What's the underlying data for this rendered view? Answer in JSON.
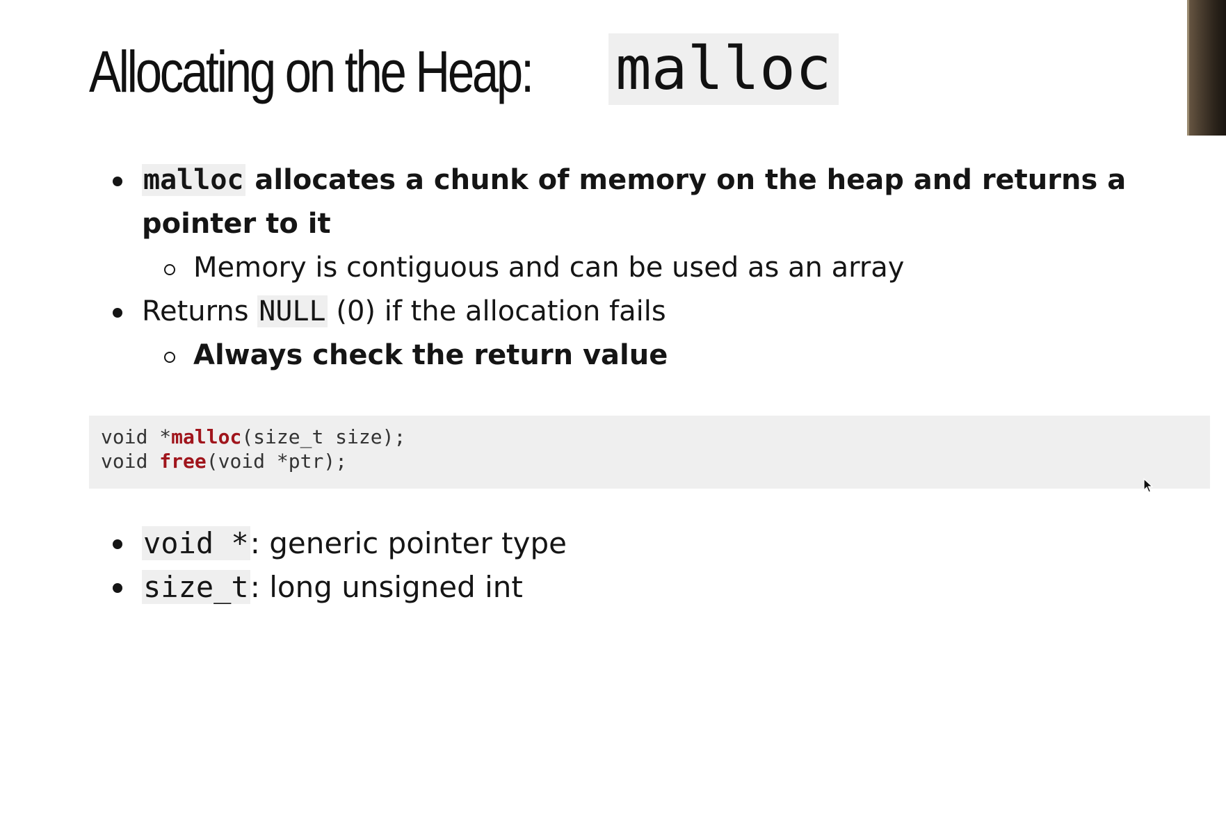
{
  "title": {
    "text": "Allocating on the Heap: ",
    "code": "malloc"
  },
  "bullets": [
    {
      "code": "malloc",
      "text": " allocates a chunk of memory on the heap and returns a pointer to it",
      "sub": "Memory is contiguous and can be used as an array"
    },
    {
      "prefix": "Returns ",
      "code": "NULL",
      "text": " (0) if the allocation fails",
      "sub": "Always check the return value"
    }
  ],
  "code_block": {
    "line1": {
      "pre": "void *",
      "fn": "malloc",
      "post": "(size_t size);"
    },
    "line2": {
      "pre": "void ",
      "fn": "free",
      "post": "(void *ptr);"
    }
  },
  "types": [
    {
      "code": "void *",
      "text": ": generic pointer type"
    },
    {
      "code": "size_t",
      "text": ": long unsigned int"
    }
  ],
  "icons": {
    "cursor": "mouse-pointer-icon"
  }
}
